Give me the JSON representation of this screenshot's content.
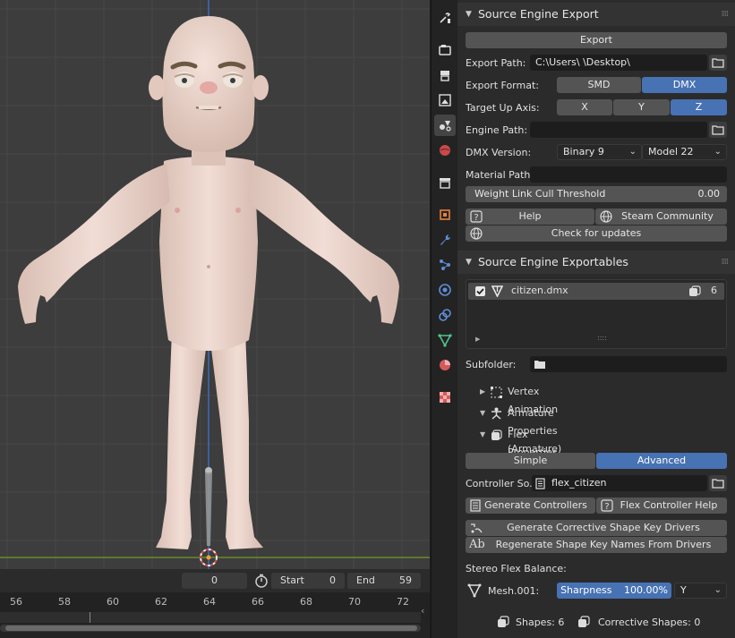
{
  "viewport": {
    "character_name": "citizen"
  },
  "timeline": {
    "current_frame": "0",
    "start_label": "Start",
    "start_value": "0",
    "end_label": "End",
    "end_value": "59",
    "ruler": [
      "56",
      "58",
      "60",
      "62",
      "64",
      "66",
      "68",
      "70",
      "72"
    ]
  },
  "tabs": [
    {
      "icon": "tool-icon"
    },
    {
      "icon": "render-icon"
    },
    {
      "icon": "output-icon"
    },
    {
      "icon": "view-layer-icon"
    },
    {
      "icon": "scene-icon",
      "active": true
    },
    {
      "icon": "world-icon"
    },
    {
      "icon": "collection-icon"
    },
    {
      "icon": "object-icon"
    },
    {
      "icon": "modifier-icon"
    },
    {
      "icon": "particles-icon"
    },
    {
      "icon": "physics-icon"
    },
    {
      "icon": "constraints-icon"
    },
    {
      "icon": "data-icon"
    },
    {
      "icon": "material-icon"
    },
    {
      "icon": "texture-icon"
    }
  ],
  "export_panel": {
    "title": "Source Engine Export",
    "export_button": "Export",
    "export_path_label": "Export Path:",
    "export_path_value": "C:\\Users\\           \\Desktop\\",
    "export_format_label": "Export Format:",
    "format_smd": "SMD",
    "format_dmx": "DMX",
    "up_axis_label": "Target Up Axis:",
    "axis_x": "X",
    "axis_y": "Y",
    "axis_z": "Z",
    "engine_path_label": "Engine Path:",
    "engine_path_value": "",
    "dmx_version_label": "DMX Version:",
    "dmx_binary": "Binary 9",
    "dmx_model": "Model 22",
    "material_path_label": "Material Path:",
    "material_path_value": "",
    "weight_link_label": "Weight Link Cull Threshold",
    "weight_link_value": "0.00",
    "help_button": "Help",
    "steam_button": "Steam Community",
    "updates_button": "Check for updates"
  },
  "exportables_panel": {
    "title": "Source Engine Exportables",
    "item_name": "citizen.dmx",
    "item_count": "6",
    "subfolder_label": "Subfolder:",
    "subfolder_value": "",
    "vertex_animation": "Vertex Animation",
    "armature_properties": "Armature Properties (Armature)",
    "flex_properties": "Flex Properties"
  },
  "flex": {
    "mode_simple": "Simple",
    "mode_advanced": "Advanced",
    "controller_label": "Controller So...",
    "controller_value": "flex_citizen",
    "generate_controllers": "Generate Controllers",
    "controller_help": "Flex Controller Help",
    "generate_corrective": "Generate Corrective Shape Key Drivers",
    "regenerate_names": "Regenerate Shape Key Names From Drivers",
    "stereo_label": "Stereo Flex Balance:",
    "mesh_name": "Mesh.001:",
    "sharpness_label": "Sharpness",
    "sharpness_value": "100.00%",
    "axis_select": "Y",
    "shapes_text": "Shapes: 6",
    "corrective_text": "Corrective Shapes: 0"
  },
  "colors": {
    "accent": "#4772b3",
    "button": "#545454",
    "panel": "#2b2b2b",
    "viewport": "#3d3d3d"
  }
}
